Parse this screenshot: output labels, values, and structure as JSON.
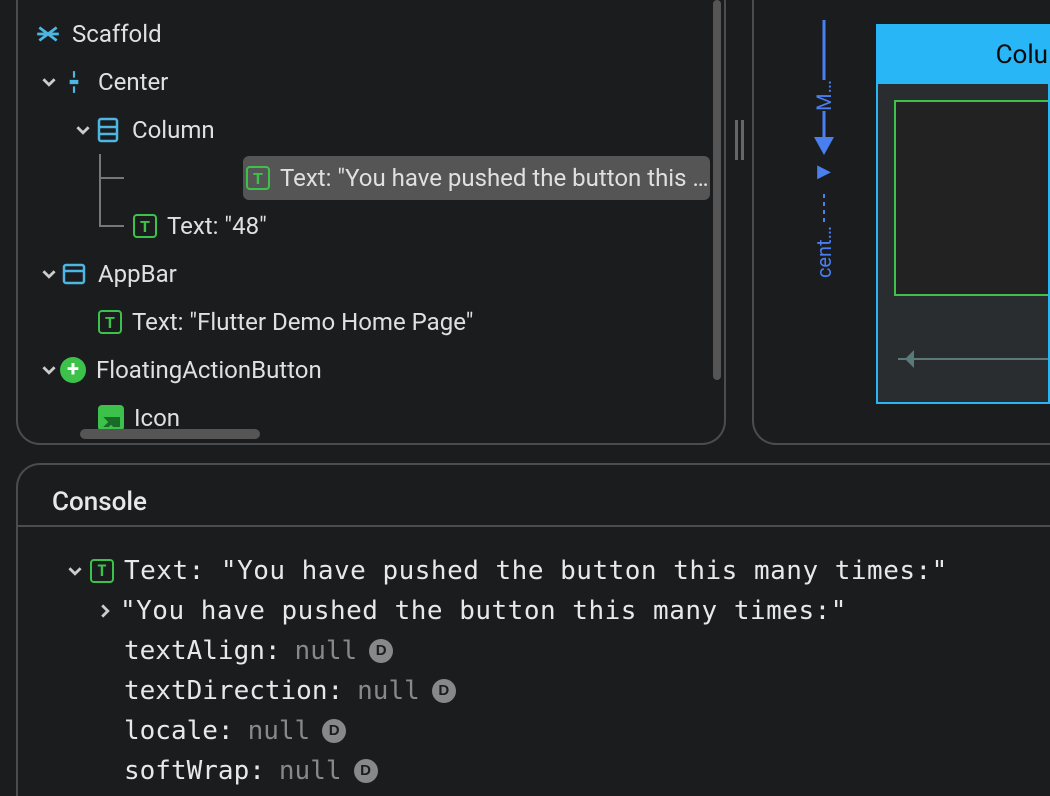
{
  "tree": {
    "scaffold": "Scaffold",
    "center": "Center",
    "column": "Column",
    "text1": "Text: \"You have pushed the button this …",
    "text2": "Text: \"48\"",
    "appbar": "AppBar",
    "appbar_text": "Text: \"Flutter Demo Home Page\"",
    "fab": "FloatingActionButton",
    "icon": "Icon"
  },
  "preview": {
    "header": "Colu",
    "axis_m": "M…",
    "axis_cent": "cent…"
  },
  "console": {
    "title": "Console",
    "main_label": "Text: \"You have pushed the button this many times:\"",
    "value": "\"You have pushed the button this many times:\"",
    "props": {
      "textAlign": {
        "label": "textAlign:",
        "value": "null"
      },
      "textDirection": {
        "label": "textDirection:",
        "value": "null"
      },
      "locale": {
        "label": "locale:",
        "value": "null"
      },
      "softWrap": {
        "label": "softWrap:",
        "value": "null"
      }
    },
    "badge": "D"
  }
}
